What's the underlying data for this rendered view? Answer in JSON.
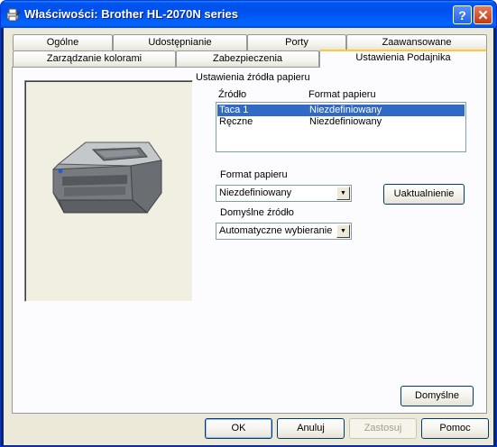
{
  "window": {
    "title": "Właściwości: Brother HL-2070N series",
    "help_glyph": "?",
    "close_glyph": "✕"
  },
  "tabs_row1": [
    {
      "label": "Ogólne"
    },
    {
      "label": "Udostępnianie"
    },
    {
      "label": "Porty"
    },
    {
      "label": "Zaawansowane"
    }
  ],
  "tabs_row2": [
    {
      "label": "Zarządzanie kolorami"
    },
    {
      "label": "Zabezpieczenia"
    },
    {
      "label": "Ustawienia Podajnika",
      "active": true
    }
  ],
  "paper_source": {
    "group_label": "Ustawienia źródła papieru",
    "col_source": "Źródło",
    "col_format": "Format papieru",
    "rows": [
      {
        "source": "Taca 1",
        "format": "Niezdefiniowany",
        "selected": true
      },
      {
        "source": "Ręczne",
        "format": "Niezdefiniowany",
        "selected": false
      }
    ]
  },
  "format": {
    "label": "Format papieru",
    "value": "Niezdefiniowany"
  },
  "update_button": "Uaktualnienie",
  "default_source": {
    "label": "Domyślne źródło",
    "value": "Automatyczne wybieranie"
  },
  "defaults_button": "Domyślne",
  "footer": {
    "ok": "OK",
    "cancel": "Anuluj",
    "apply": "Zastosuj",
    "help": "Pomoc"
  },
  "colors": {
    "titlebar": "#0055ea",
    "selection": "#316ac5",
    "active_tab_accent": "#ffc83c",
    "dialog_bg": "#ece9d8"
  },
  "icons": [
    "printer-properties-icon",
    "help-icon",
    "close-icon",
    "printer-image",
    "dropdown-arrow-icon"
  ]
}
